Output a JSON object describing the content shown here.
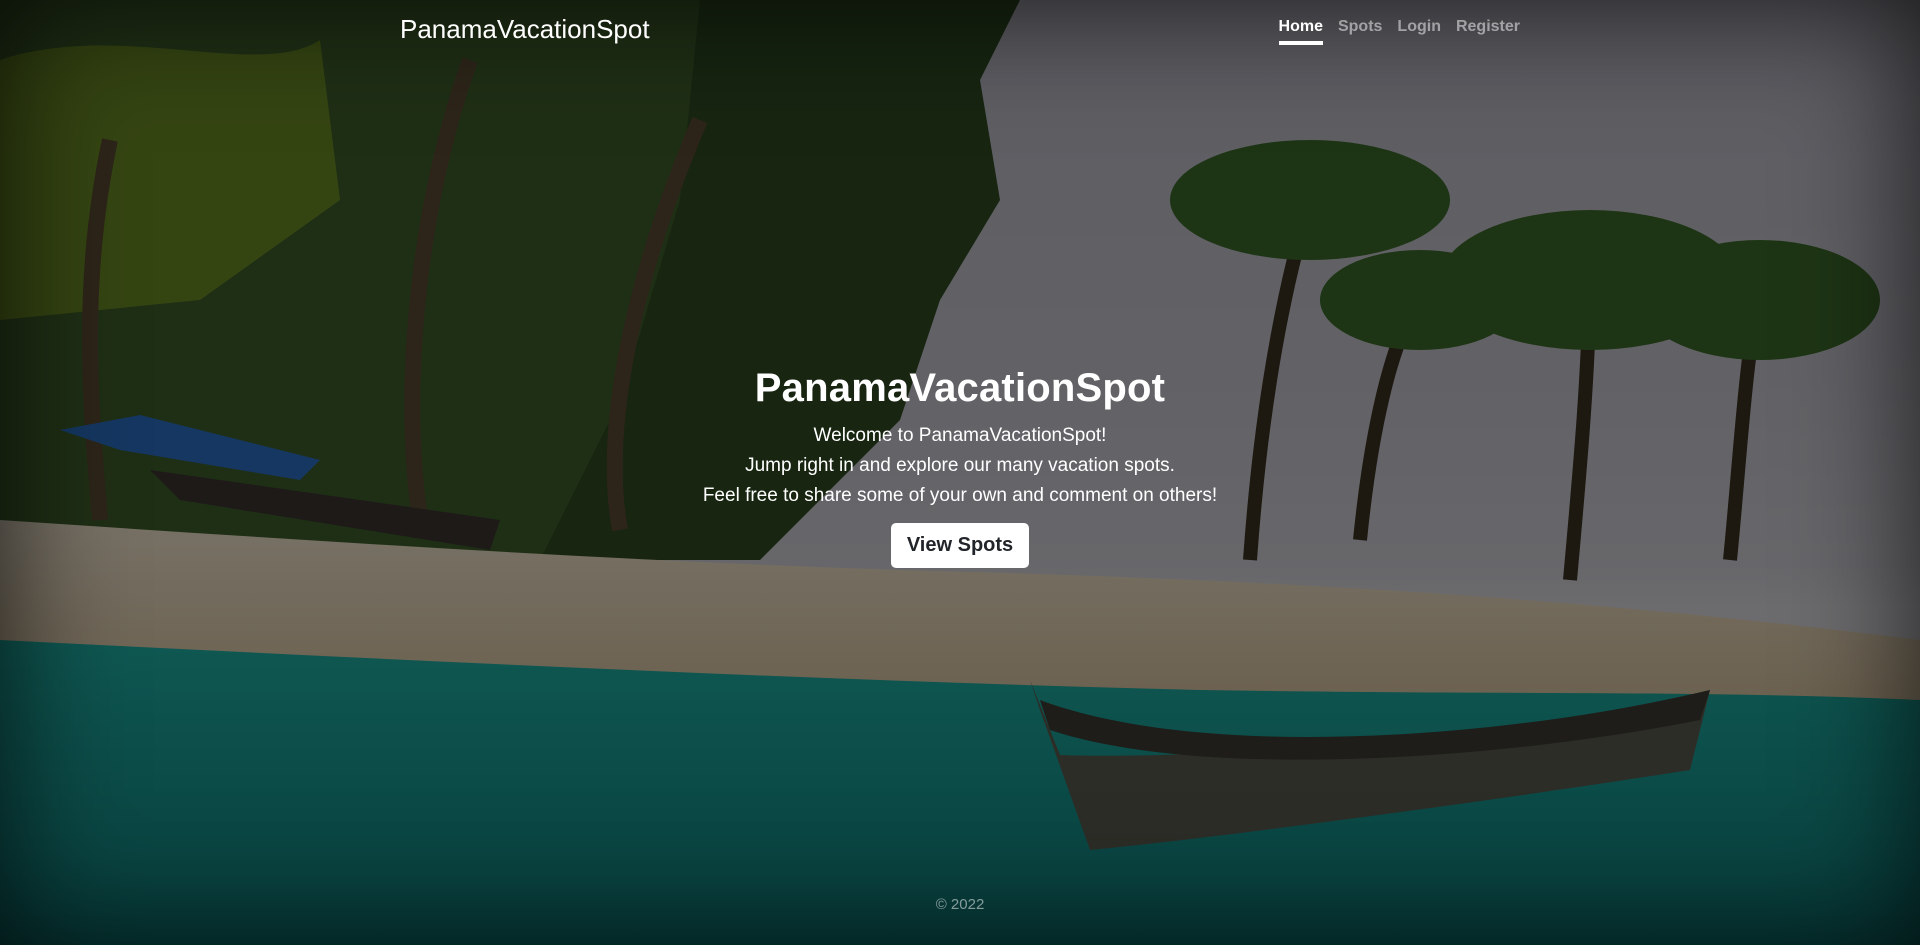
{
  "nav": {
    "brand": "PanamaVacationSpot",
    "links": [
      {
        "label": "Home",
        "active": true
      },
      {
        "label": "Spots",
        "active": false
      },
      {
        "label": "Login",
        "active": false
      },
      {
        "label": "Register",
        "active": false
      }
    ]
  },
  "hero": {
    "title": "PanamaVacationSpot",
    "lines": [
      "Welcome to PanamaVacationSpot!",
      "Jump right in and explore our many vacation spots.",
      "Feel free to share some of your own and comment on others!"
    ],
    "button_label": "View Spots"
  },
  "footer": {
    "copyright": "© 2022"
  },
  "colors": {
    "sea": "#1aa39a",
    "sand": "#e9dcc6",
    "palm_leaf": "#3d7a2a",
    "overlay": "rgba(0,0,0,0.5)"
  }
}
